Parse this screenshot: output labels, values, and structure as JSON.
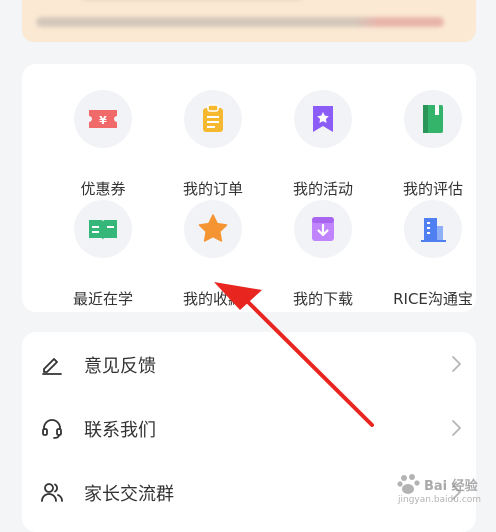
{
  "grid": {
    "items": [
      {
        "label": "优惠券",
        "icon": "coupon-icon",
        "color": "#f06a6a"
      },
      {
        "label": "我的订单",
        "icon": "clipboard-icon",
        "color": "#f5b82e"
      },
      {
        "label": "我的活动",
        "icon": "bookmark-star-icon",
        "color": "#8b5cf6"
      },
      {
        "label": "我的评估",
        "icon": "notebook-icon",
        "color": "#34b36a"
      },
      {
        "label": "最近在学",
        "icon": "open-book-icon",
        "color": "#35b77a"
      },
      {
        "label": "我的收藏",
        "icon": "star-icon",
        "color": "#f59433"
      },
      {
        "label": "我的下载",
        "icon": "download-box-icon",
        "color": "#c084fc"
      },
      {
        "label": "RICE沟通宝",
        "icon": "building-icon",
        "color": "#4f7ff0"
      }
    ]
  },
  "menu": {
    "items": [
      {
        "label": "意见反馈",
        "icon": "pencil-icon"
      },
      {
        "label": "联系我们",
        "icon": "headset-icon"
      },
      {
        "label": "家长交流群",
        "icon": "users-icon"
      }
    ]
  },
  "watermark": {
    "text": "Bai 经验",
    "sub": "jingyan.baidu.com"
  },
  "colors": {
    "background": "#f4f5f7",
    "card": "#ffffff",
    "banner": "#fbe9d3",
    "arrow": "#e8251f"
  }
}
